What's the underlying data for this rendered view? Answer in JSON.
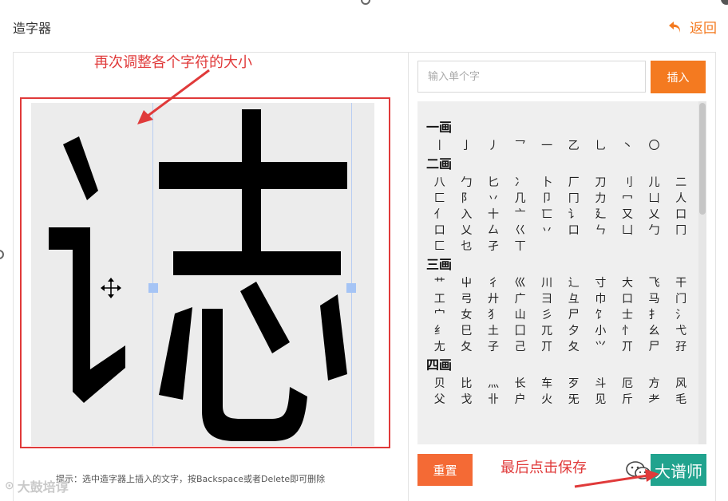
{
  "header": {
    "title": "造字器",
    "back_label": "返回",
    "back_icon": "undo-arrow-icon"
  },
  "colors": {
    "accent": "#f47a20",
    "annotation": "#e03a3a",
    "save": "#21a38e",
    "reset": "#f46a35"
  },
  "annotations": {
    "top": "再次调整各个字符的大小",
    "save": "最后点击保存"
  },
  "editor": {
    "hint": "提示：选中造字器上插入的文字，按Backspace或者Delete即可删除",
    "composed_glyph": "誌"
  },
  "input": {
    "placeholder": "输入单个字",
    "value": ""
  },
  "buttons": {
    "insert": "插入",
    "reset": "重置",
    "save": "大谱师"
  },
  "stroke_sections": [
    {
      "title": "一画",
      "chars": [
        "丨",
        "亅",
        "丿",
        "乛",
        "一",
        "乙",
        "乚",
        "丶",
        "〇"
      ]
    },
    {
      "title": "二画",
      "chars": [
        "八",
        "勹",
        "匕",
        "冫",
        "卜",
        "厂",
        "刀",
        "刂",
        "儿",
        "二",
        "匚",
        "阝",
        "丷",
        "几",
        "卩",
        "冂",
        "力",
        "冖",
        "凵",
        "人",
        "亻",
        "入",
        "十",
        "亠",
        "匸",
        "讠",
        "廴",
        "又",
        "乂",
        "口",
        "口",
        "乂",
        "厶",
        "巜",
        "丷",
        "口",
        "ㄣ",
        "凵",
        "勹",
        "冂",
        "匚",
        "乜",
        "孑",
        "丅"
      ]
    },
    {
      "title": "三画",
      "chars": [
        "艹",
        "屮",
        "彳",
        "巛",
        "川",
        "辶",
        "寸",
        "大",
        "飞",
        "干",
        "工",
        "弓",
        "廾",
        "广",
        "彐",
        "彑",
        "巾",
        "口",
        "马",
        "门",
        "宀",
        "女",
        "犭",
        "山",
        "彡",
        "尸",
        "饣",
        "士",
        "扌",
        "氵",
        "纟",
        "巳",
        "土",
        "囗",
        "兀",
        "夕",
        "小",
        "忄",
        "幺",
        "弋",
        "尢",
        "夂",
        "子",
        "己",
        "丌",
        "夂",
        "⺍",
        "丌",
        "尸",
        "孖"
      ]
    },
    {
      "title": "四画",
      "chars": [
        "贝",
        "比",
        "灬",
        "长",
        "车",
        "歹",
        "斗",
        "厄",
        "方",
        "风",
        "父",
        "戈",
        "卝",
        "户",
        "火",
        "旡",
        "见",
        "斤",
        "耂",
        "毛"
      ]
    }
  ],
  "watermark": {
    "text": "大鼓培谆",
    "logo_icon": "watermark-logo-icon"
  }
}
